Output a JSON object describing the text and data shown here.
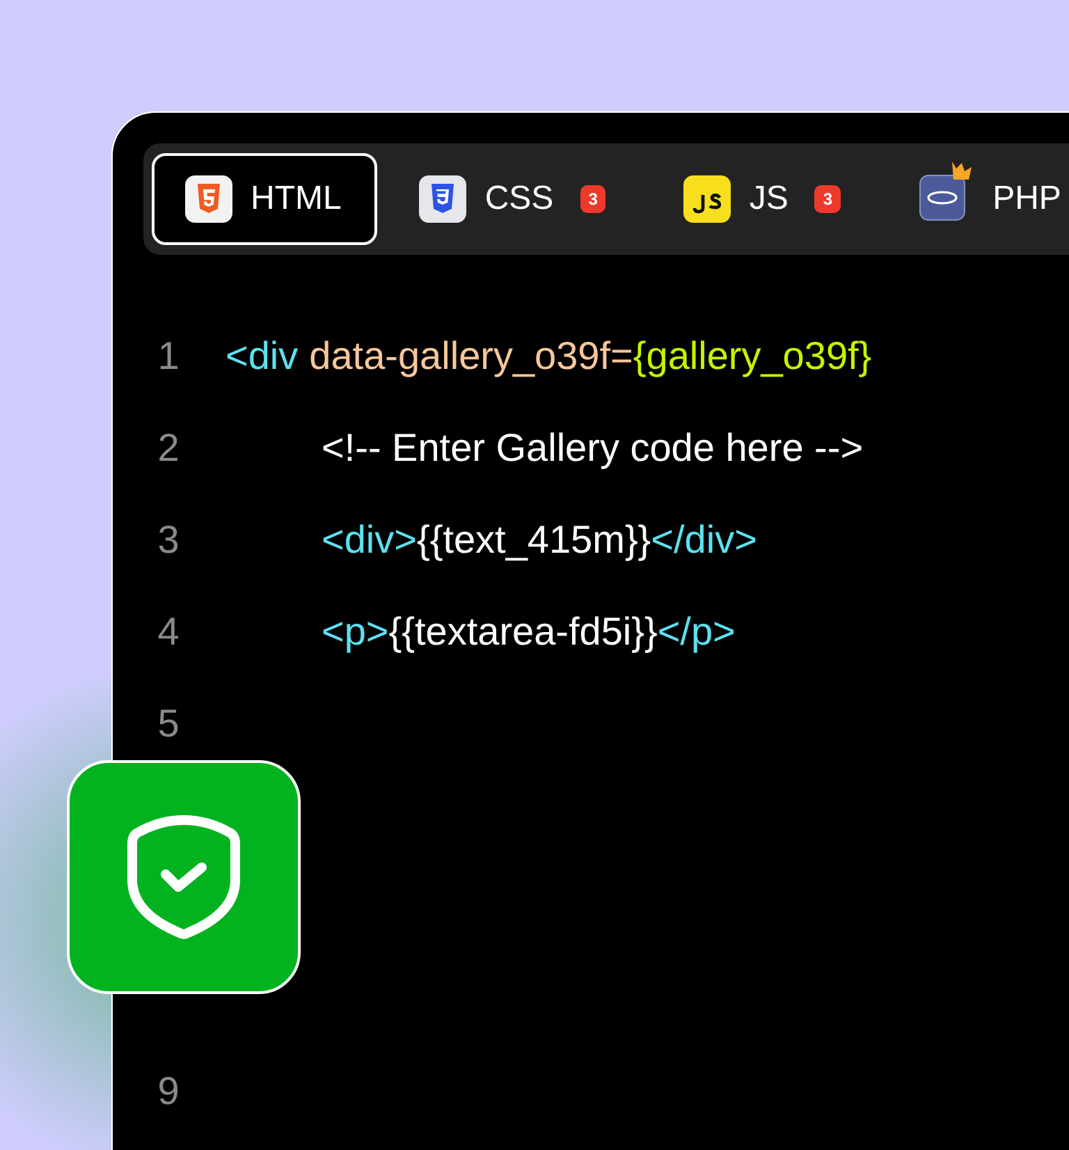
{
  "tabs": [
    {
      "kind": "html",
      "label": "HTML",
      "selected": true
    },
    {
      "kind": "css",
      "label": "CSS",
      "count": "3",
      "selected": false
    },
    {
      "kind": "js",
      "label": "JS",
      "count": "3",
      "selected": false
    },
    {
      "kind": "php",
      "label": "PHP",
      "selected": false
    }
  ],
  "editor": {
    "lines": [
      {
        "number": "1",
        "tokens": [
          {
            "kind": "tag",
            "text": "<div"
          },
          {
            "kind": "attr",
            "text": "data-gallery_o39f="
          },
          {
            "kind": "value",
            "text": "{gallery_o39f}"
          }
        ],
        "children": [
          {
            "number": "2",
            "tokens": [
              {
                "kind": "comment",
                "text": "<!-- Enter Gallery code here -->"
              }
            ]
          },
          {
            "number": "3",
            "tokens": [
              {
                "kind": "tag",
                "text": "<div>"
              },
              {
                "kind": "text",
                "text": "{{text_415m}}"
              },
              {
                "kind": "tag",
                "text": "</div>"
              }
            ]
          },
          {
            "number": "4",
            "tokens": [
              {
                "kind": "tag",
                "text": "<p>"
              },
              {
                "kind": "text",
                "text": "{{textarea-fd5i}}"
              },
              {
                "kind": "tag",
                "text": "</p>"
              }
            ]
          }
        ]
      },
      {
        "number": "5"
      },
      {
        "number": "9"
      }
    ]
  }
}
